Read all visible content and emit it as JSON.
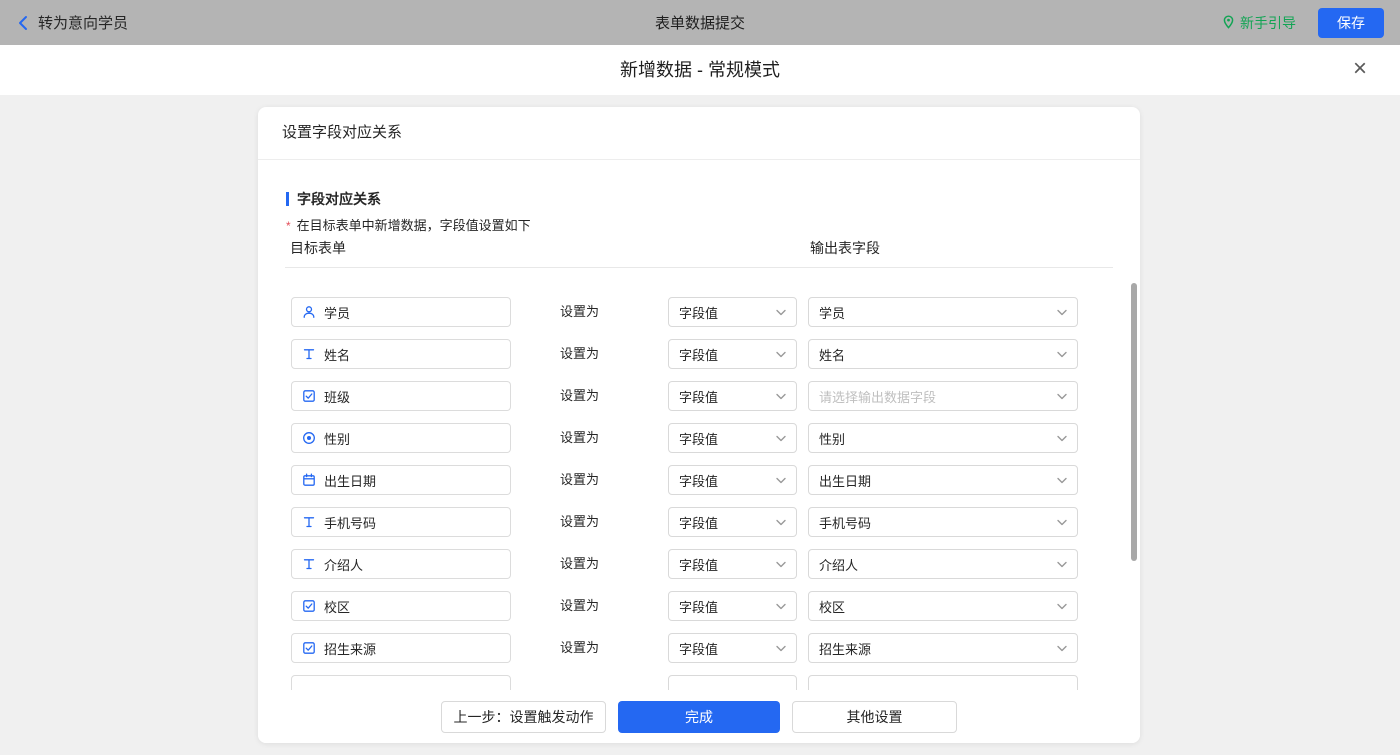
{
  "topbar": {
    "back_label": "转为意向学员",
    "title": "表单数据提交",
    "guide_label": "新手引导",
    "save_label": "保存"
  },
  "header": {
    "title": "新增数据 - 常规模式",
    "close_glyph": "×"
  },
  "card": {
    "header": "设置字段对应关系",
    "section_title": "字段对应关系",
    "note_mark": "*",
    "note": "在目标表单中新增数据，字段值设置如下",
    "col_left": "目标表单",
    "col_right": "输出表字段",
    "set_as": "设置为",
    "field_value": "字段值",
    "rows": [
      {
        "field": "学员",
        "icon": "person-icon",
        "value": "学员",
        "placeholder": false
      },
      {
        "field": "姓名",
        "icon": "text-icon",
        "value": "姓名",
        "placeholder": false
      },
      {
        "field": "班级",
        "icon": "checkbox-icon",
        "value": "请选择输出数据字段",
        "placeholder": true
      },
      {
        "field": "性别",
        "icon": "radio-icon",
        "value": "性别",
        "placeholder": false
      },
      {
        "field": "出生日期",
        "icon": "calendar-icon",
        "value": "出生日期",
        "placeholder": false
      },
      {
        "field": "手机号码",
        "icon": "text-icon",
        "value": "手机号码",
        "placeholder": false
      },
      {
        "field": "介绍人",
        "icon": "text-icon",
        "value": "介绍人",
        "placeholder": false
      },
      {
        "field": "校区",
        "icon": "checkbox-icon",
        "value": "校区",
        "placeholder": false
      },
      {
        "field": "招生来源",
        "icon": "checkbox-icon",
        "value": "招生来源",
        "placeholder": false
      },
      {
        "field": "",
        "icon": "",
        "value": "",
        "placeholder": false,
        "partial": true
      }
    ],
    "footer": {
      "prev_label": "上一步：设置触发动作",
      "done_label": "完成",
      "other_label": "其他设置"
    }
  },
  "colors": {
    "primary": "#2468f2",
    "green": "#12a454",
    "red": "#e34d59",
    "topbar": "#b4b4b4"
  }
}
